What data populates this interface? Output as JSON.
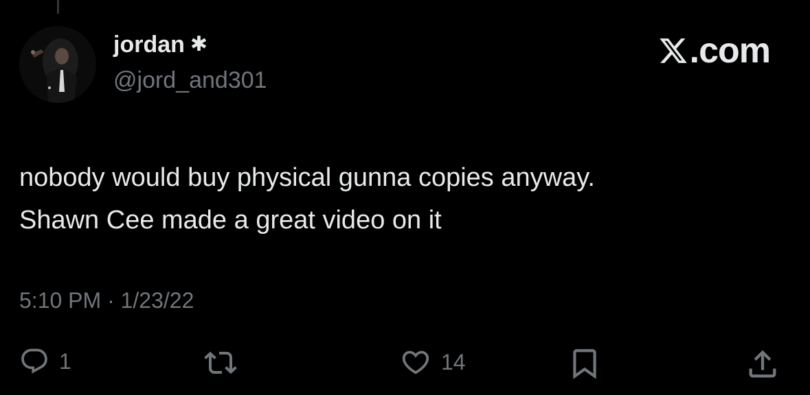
{
  "tweet": {
    "display_name": "jordan",
    "name_emoji": "✱",
    "handle": "@jord_and301",
    "text_lines": [
      "nobody would buy physical gunna copies anyway.",
      "Shawn Cee made a great video on it"
    ],
    "timestamp": "5:10 PM · 1/23/22"
  },
  "brand": {
    "text": ".com",
    "icon": "x-logo-icon"
  },
  "actions": {
    "reply": {
      "icon": "reply-icon",
      "count": "1"
    },
    "retweet": {
      "icon": "retweet-icon",
      "count": ""
    },
    "like": {
      "icon": "heart-icon",
      "count": "14"
    },
    "bookmark": {
      "icon": "bookmark-icon"
    },
    "share": {
      "icon": "share-icon"
    }
  },
  "colors": {
    "background": "#000000",
    "primary_text": "#e7e9ea",
    "secondary_text": "#71767b"
  }
}
